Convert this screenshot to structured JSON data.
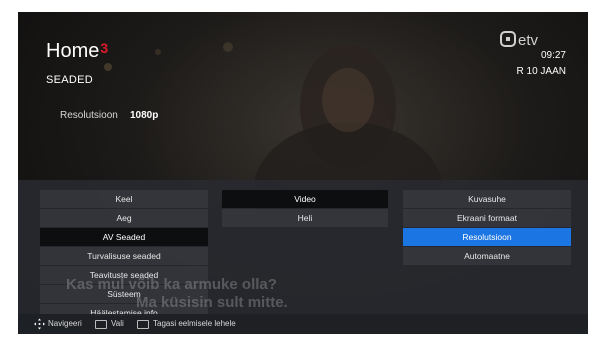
{
  "brand": {
    "title": "Home",
    "mark": "3"
  },
  "section_title": "SEADED",
  "current_setting": {
    "label": "Resolutsioon",
    "value": "1080p"
  },
  "channel_logo": "etv",
  "clock": {
    "time": "09:27",
    "date": "R 10 JAAN"
  },
  "menu_col1": [
    {
      "label": "Keel"
    },
    {
      "label": "Aeg"
    },
    {
      "label": "AV Seaded"
    },
    {
      "label": "Turvalisuse seaded"
    },
    {
      "label": "Teavituste seaded"
    },
    {
      "label": "Süsteem"
    },
    {
      "label": "Häälestamise info"
    }
  ],
  "menu_col2": [
    {
      "label": "Video"
    },
    {
      "label": "Heli"
    }
  ],
  "menu_col3": [
    {
      "label": "Kuvasuhe"
    },
    {
      "label": "Ekraani formaat"
    },
    {
      "label": "Resolutsioon"
    },
    {
      "label": "Automaatne"
    }
  ],
  "subtitle_lines": [
    "Kas mul võib ka armuke olla?",
    "Ma küsisin sult mitte."
  ],
  "hints": {
    "navigate": "Navigeeri",
    "select": "Vali",
    "back": "Tagasi eelmisele lehele"
  },
  "colors": {
    "accent": "#1b75e3",
    "brand_mark": "#e0182b"
  },
  "icons": [
    "dpad-icon",
    "ok-button-icon",
    "back-button-icon"
  ]
}
